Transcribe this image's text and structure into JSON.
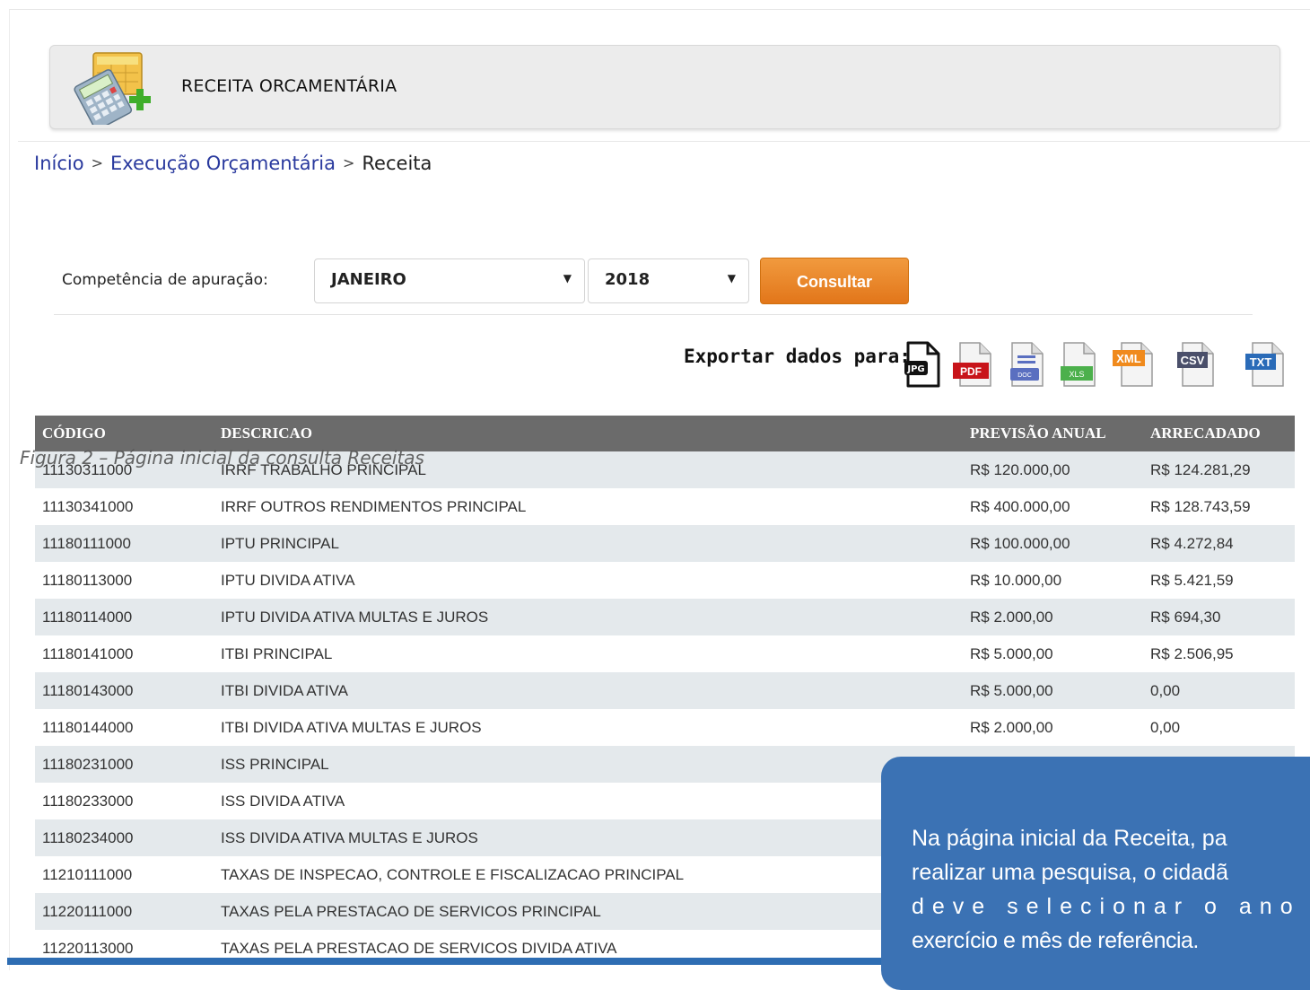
{
  "header": {
    "title": "RECEITA ORCAMENTÁRIA",
    "icon": "calculator-add-icon"
  },
  "breadcrumb": {
    "home": "Início",
    "section": "Execução Orçamentária",
    "current": "Receita",
    "separator": ">"
  },
  "filter": {
    "label": "Competência de apuração:",
    "month": "JANEIRO",
    "year": "2018",
    "button": "Consultar"
  },
  "export": {
    "label": "Exportar dados para:",
    "formats": [
      "JPG",
      "PDF",
      "DOC",
      "XLS",
      "XML",
      "CSV",
      "TXT"
    ]
  },
  "table": {
    "headers": [
      "CÓDIGO",
      "DESCRICAO",
      "PREVISÃO ANUAL",
      "ARRECADADO"
    ],
    "rows": [
      [
        "11130311000",
        "IRRF TRABALHO PRINCIPAL",
        "R$ 120.000,00",
        "R$ 124.281,29"
      ],
      [
        "11130341000",
        "IRRF OUTROS RENDIMENTOS PRINCIPAL",
        "R$ 400.000,00",
        "R$ 128.743,59"
      ],
      [
        "11180111000",
        "IPTU PRINCIPAL",
        "R$ 100.000,00",
        "R$ 4.272,84"
      ],
      [
        "11180113000",
        "IPTU DIVIDA ATIVA",
        "R$ 10.000,00",
        "R$ 5.421,59"
      ],
      [
        "11180114000",
        "IPTU DIVIDA ATIVA MULTAS E JUROS",
        "R$ 2.000,00",
        "R$ 694,30"
      ],
      [
        "11180141000",
        "ITBI PRINCIPAL",
        "R$ 5.000,00",
        "R$ 2.506,95"
      ],
      [
        "11180143000",
        "ITBI DIVIDA ATIVA",
        "R$ 5.000,00",
        "0,00"
      ],
      [
        "11180144000",
        "ITBI DIVIDA ATIVA MULTAS E JUROS",
        "R$ 2.000,00",
        "0,00"
      ],
      [
        "11180231000",
        "ISS PRINCIPAL",
        "",
        ""
      ],
      [
        "11180233000",
        "ISS DIVIDA ATIVA",
        "",
        ""
      ],
      [
        "11180234000",
        "ISS DIVIDA ATIVA MULTAS E JUROS",
        "",
        ""
      ],
      [
        "11210111000",
        "TAXAS DE INSPECAO, CONTROLE E FISCALIZACAO PRINCIPAL",
        "",
        ""
      ],
      [
        "11220111000",
        "TAXAS PELA PRESTACAO DE SERVICOS PRINCIPAL",
        "",
        ""
      ],
      [
        "11220113000",
        "TAXAS PELA PRESTACAO DE SERVICOS DIVIDA ATIVA",
        "",
        ""
      ]
    ]
  },
  "caption": "Figura 2 – Página inicial da consulta Receitas",
  "callout": {
    "line1": "Na página inicial da Receita, pa",
    "line2": "realizar uma pesquisa, o cidadã",
    "line3": "deve selecionar o ano d",
    "line4": "exercício e mês de referência."
  },
  "colors": {
    "accent": "#e8801f",
    "table_header": "#6b6b6b",
    "callout": "#3b72b4",
    "link": "#2a3a9e"
  }
}
